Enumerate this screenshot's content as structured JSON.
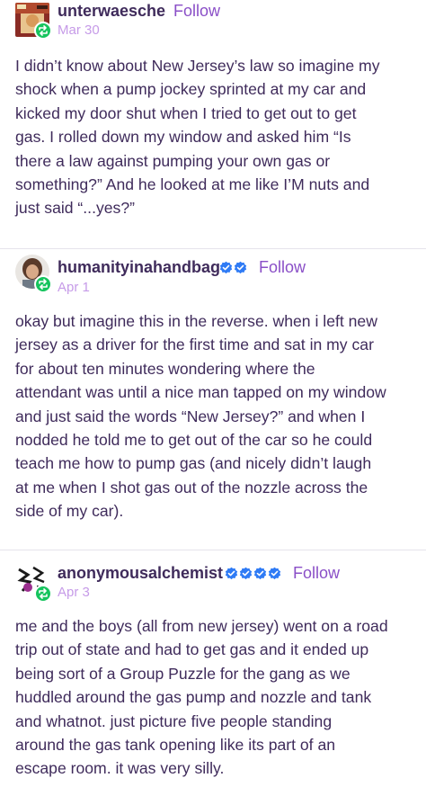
{
  "posts": [
    {
      "username": "unterwaesche",
      "verified_badges": 0,
      "follow_label": "Follow",
      "date": "Mar 30",
      "lines": [
        "I didn’t know about New Jersey’s law so imagine my",
        "shock when a pump jockey sprinted at my car and",
        "kicked my door shut when I tried to get out to get",
        "gas. I rolled down my window and asked him “Is",
        "there a law against pumping your own gas or",
        "something?” And he looked at me like I’M nuts and",
        "just said “...yes?”"
      ]
    },
    {
      "username": "humanityinahandbag",
      "verified_badges": 2,
      "follow_label": "Follow",
      "date": "Apr 1",
      "lines": [
        "okay but imagine this in the reverse. when i left new",
        "jersey as a driver for the first time and sat in my car",
        "for about ten minutes wondering where the",
        "attendant was until a nice man tapped on my window",
        "and just said the words “New Jersey?” and when I",
        "nodded he told me to get out of the car so he could",
        "teach me how to pump gas (and nicely didn’t laugh",
        "at me when I shot gas out of the nozzle across the",
        "side of my car)."
      ]
    },
    {
      "username": "anonymousalchemist",
      "verified_badges": 4,
      "follow_label": "Follow",
      "date": "Apr 3",
      "lines": [
        "me and the boys (all from new jersey) went on a road",
        "trip out of state and had to get gas and it ended up",
        "being sort of a Group Puzzle for the gang as we",
        "huddled around the gas pump and nozzle and tank",
        "and whatnot. just picture five people standing",
        "around the gas tank opening like its part of an",
        "escape room. it was very silly."
      ]
    }
  ],
  "colors": {
    "text": "#3f2b5b",
    "follow": "#8a4fc7",
    "date": "#c69be8",
    "reblog_badge": "#16c45e",
    "verified_badge": "#2f7bf5",
    "divider": "#e6e3eb"
  },
  "icons": {
    "reblog": "reblog-icon",
    "verified": "verified-badge-icon"
  }
}
